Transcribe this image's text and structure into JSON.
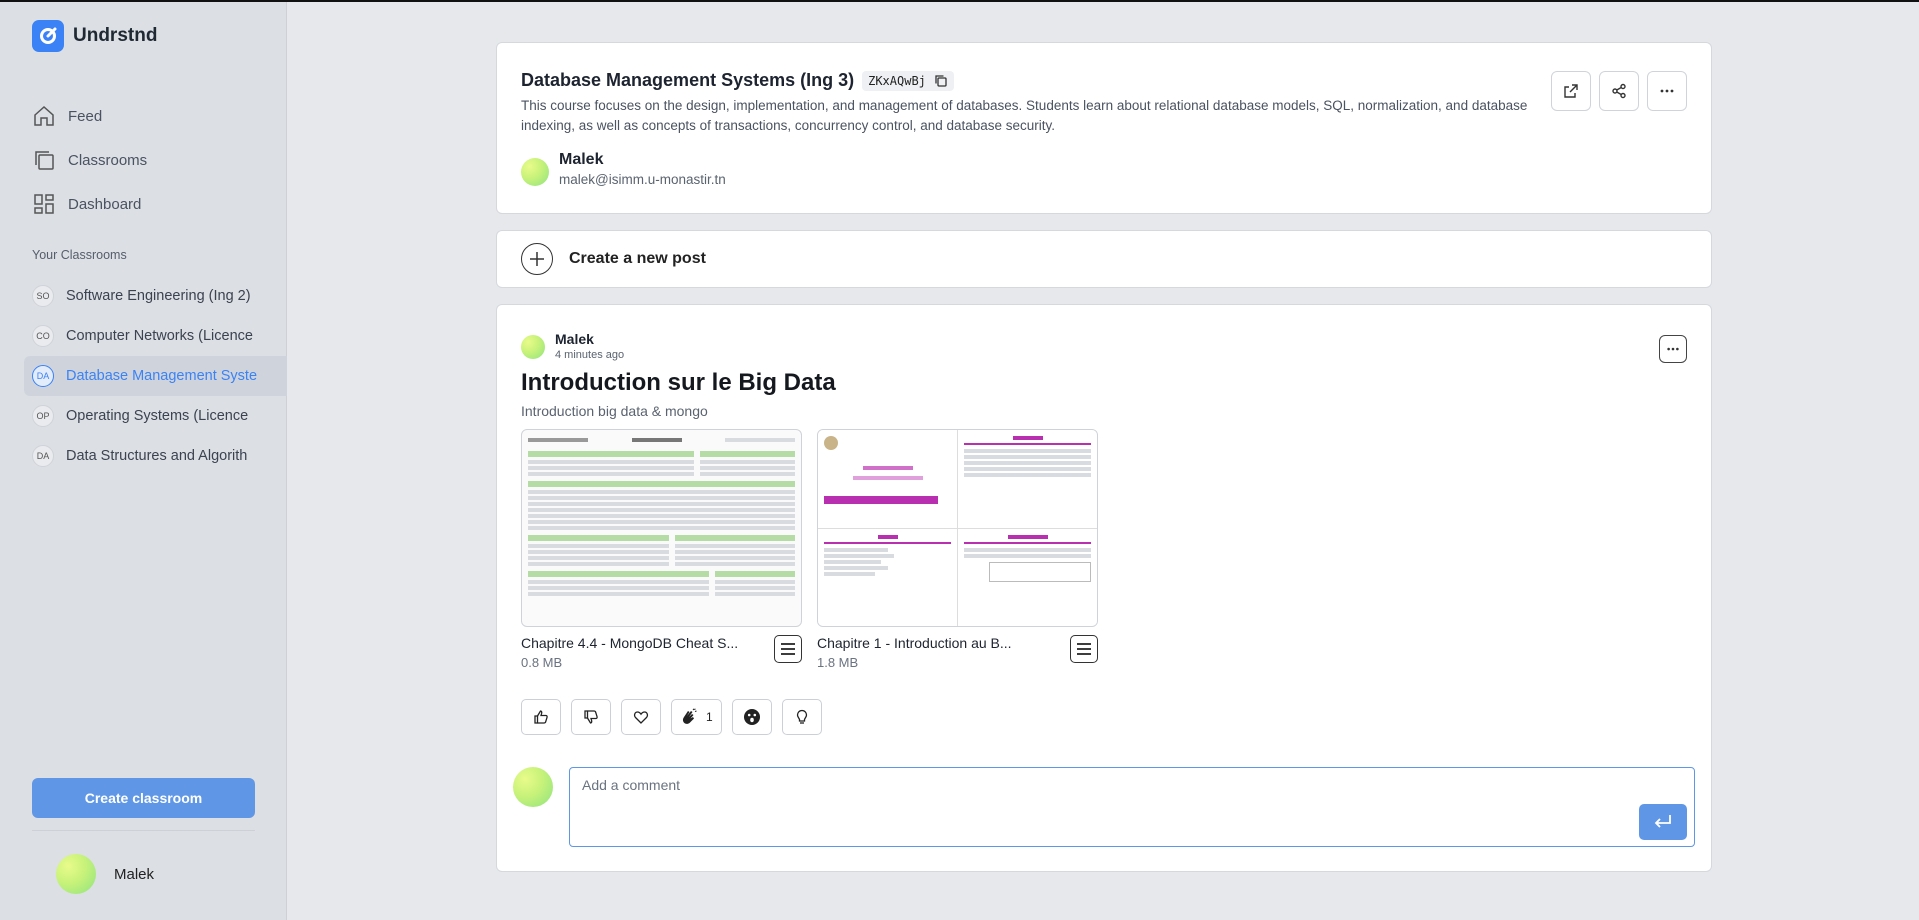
{
  "brand": {
    "name": "Undrstnd",
    "color": "#3b82f6"
  },
  "nav": [
    {
      "label": "Feed",
      "icon": "home-icon"
    },
    {
      "label": "Classrooms",
      "icon": "classrooms-icon"
    },
    {
      "label": "Dashboard",
      "icon": "dashboard-icon"
    }
  ],
  "sidebar": {
    "section_label": "Your Classrooms",
    "classrooms": [
      {
        "badge": "SO",
        "name": "Software Engineering (Ing 2)",
        "active": false
      },
      {
        "badge": "CO",
        "name": "Computer Networks (Licence",
        "active": false
      },
      {
        "badge": "DA",
        "name": "Database Management Syste",
        "active": true
      },
      {
        "badge": "OP",
        "name": "Operating Systems (Licence",
        "active": false
      },
      {
        "badge": "DA",
        "name": "Data Structures and Algorith",
        "active": false
      }
    ],
    "create_button": "Create classroom",
    "user_name": "Malek"
  },
  "course": {
    "title": "Database Management Systems (Ing 3)",
    "code": "ZKxAQwBj",
    "description": "This course focuses on the design, implementation, and management of databases. Students learn about relational database models, SQL, normalization, and database indexing, as well as concepts of transactions, concurrency control, and database security.",
    "owner_name": "Malek",
    "owner_email": "malek@isimm.u-monastir.tn"
  },
  "new_post": {
    "label": "Create a new post"
  },
  "post": {
    "author": "Malek",
    "time": "4 minutes ago",
    "title": "Introduction sur le Big Data",
    "subtitle": "Introduction big data & mongo",
    "attachments": [
      {
        "name": "Chapitre 4.4 - MongoDB Cheat S...",
        "size": "0.8 MB"
      },
      {
        "name": "Chapitre 1 - Introduction au B...",
        "size": "1.8 MB"
      }
    ],
    "reactions": [
      {
        "icon": "thumbs-up-icon",
        "count": ""
      },
      {
        "icon": "thumbs-down-icon",
        "count": ""
      },
      {
        "icon": "heart-icon",
        "count": ""
      },
      {
        "icon": "clap-icon",
        "count": "1"
      },
      {
        "icon": "surprised-face-icon",
        "count": ""
      },
      {
        "icon": "lightbulb-icon",
        "count": ""
      }
    ],
    "comment_placeholder": "Add a comment"
  }
}
